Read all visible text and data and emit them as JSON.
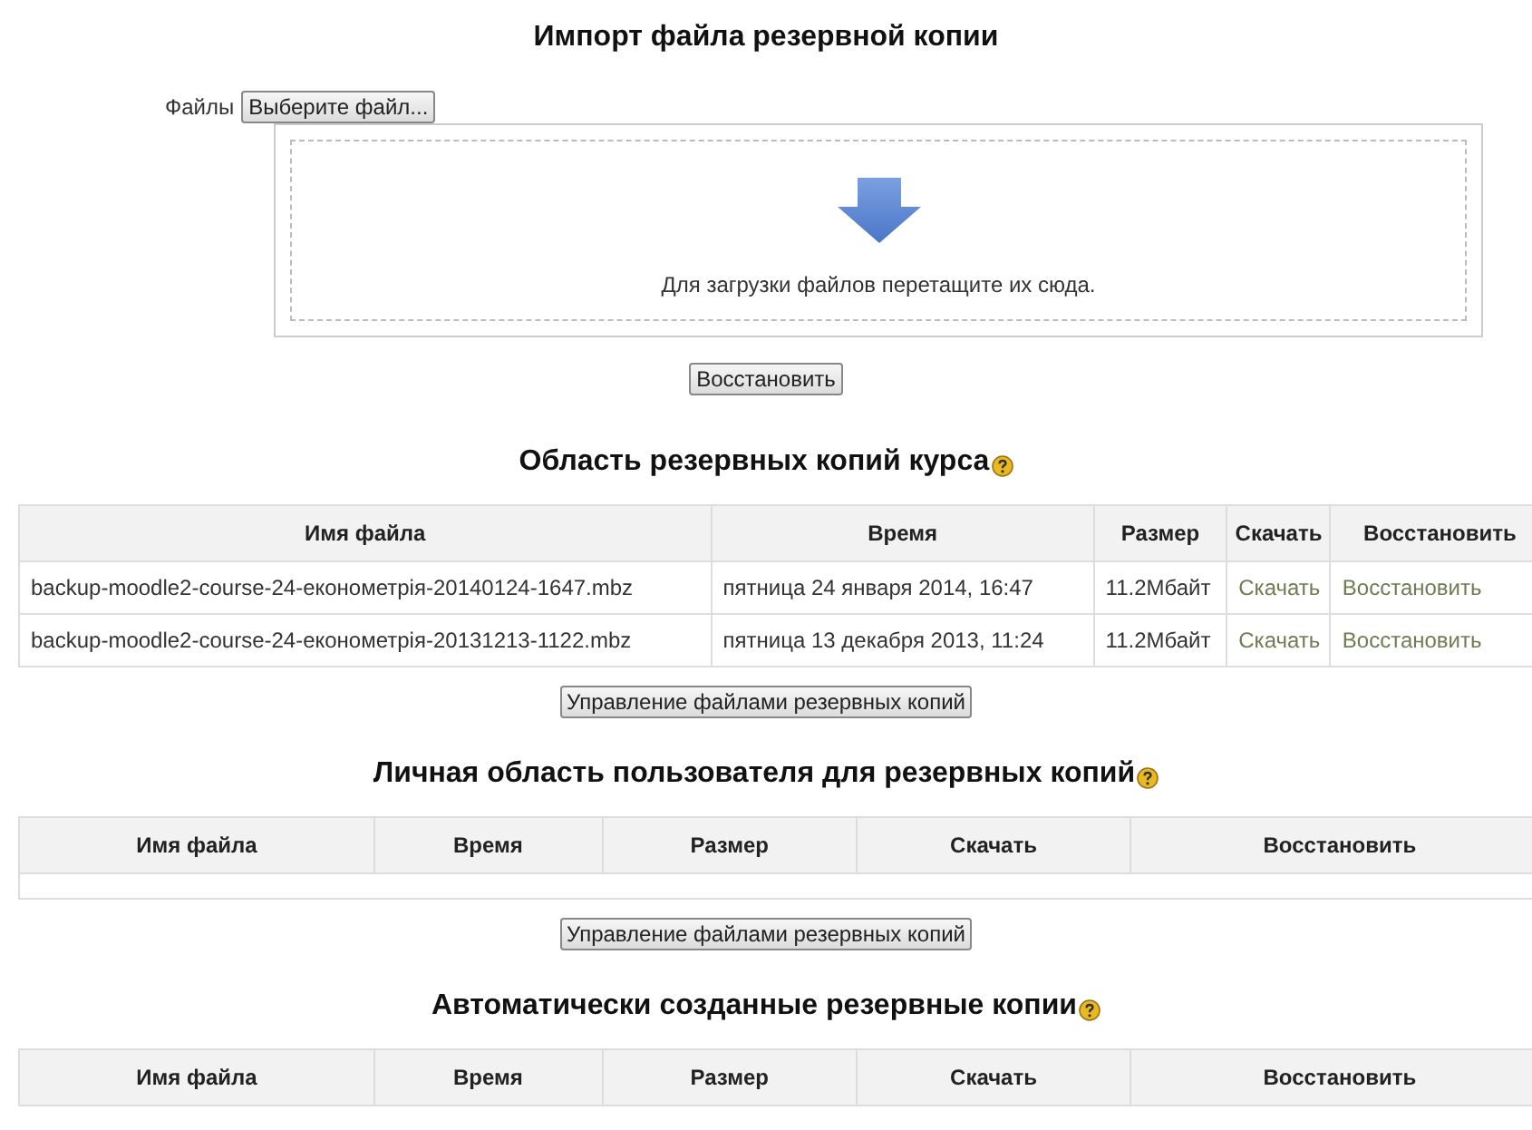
{
  "import": {
    "title": "Импорт файла резервной копии",
    "files_label": "Файлы",
    "choose_button": "Выберите файл...",
    "drop_hint": "Для загрузки файлов перетащите их сюда.",
    "restore_button": "Восстановить"
  },
  "areas": [
    {
      "title": "Область резервных копий курса",
      "columns": [
        "Имя файла",
        "Время",
        "Размер",
        "Скачать",
        "Восстановить"
      ],
      "rows": [
        {
          "file": "backup-moodle2-course-24-економетрія-20140124-1647.mbz",
          "time": "пятница 24 января 2014, 16:47",
          "size": "11.2Мбайт",
          "download": "Скачать",
          "restore": "Восстановить"
        },
        {
          "file": "backup-moodle2-course-24-економетрія-20131213-1122.mbz",
          "time": "пятница 13 декабря 2013, 11:24",
          "size": "11.2Мбайт",
          "download": "Скачать",
          "restore": "Восстановить"
        }
      ],
      "manage_button": "Управление файлами резервных копий"
    },
    {
      "title": "Личная область пользователя для резервных копий",
      "columns": [
        "Имя файла",
        "Время",
        "Размер",
        "Скачать",
        "Восстановить"
      ],
      "manage_button": "Управление файлами резервных копий"
    },
    {
      "title": "Автоматически созданные резервные копии",
      "columns": [
        "Имя файла",
        "Время",
        "Размер",
        "Скачать",
        "Восстановить"
      ]
    }
  ]
}
